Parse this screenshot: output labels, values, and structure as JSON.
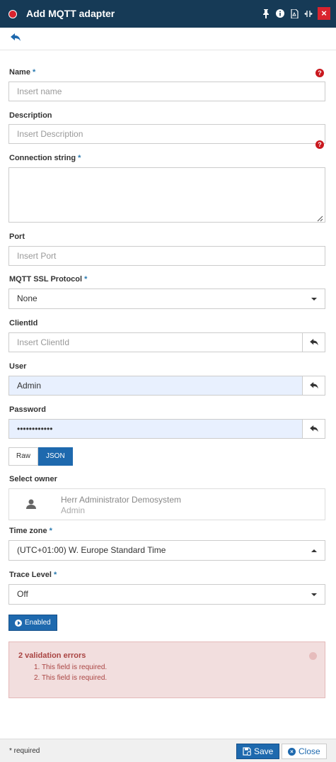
{
  "window": {
    "title": "Add MQTT adapter",
    "close_glyph": "×",
    "icons": [
      "pin-icon",
      "info-icon",
      "pdf-icon",
      "resize-icon"
    ]
  },
  "form": {
    "name": {
      "label": "Name",
      "required_mark": "*",
      "placeholder": "Insert name"
    },
    "description": {
      "label": "Description",
      "placeholder": "Insert Description"
    },
    "connection_string": {
      "label": "Connection string",
      "required_mark": "*"
    },
    "port": {
      "label": "Port",
      "placeholder": "Insert Port"
    },
    "ssl_protocol": {
      "label": "MQTT SSL Protocol",
      "required_mark": "*",
      "value": "None"
    },
    "client_id": {
      "label": "ClientId",
      "placeholder": "Insert ClientId"
    },
    "user": {
      "label": "User",
      "value": "Admin"
    },
    "password": {
      "label": "Password",
      "value": "••••••••••••"
    },
    "format_toggle": {
      "options": [
        "Raw",
        "JSON"
      ],
      "selected": "JSON"
    },
    "owner": {
      "label": "Select owner",
      "name": "Herr Administrator Demosystem",
      "sub": "Admin"
    },
    "time_zone": {
      "label": "Time zone",
      "required_mark": "*",
      "value": "(UTC+01:00) W. Europe Standard Time"
    },
    "trace_level": {
      "label": "Trace Level",
      "required_mark": "*",
      "value": "Off"
    },
    "enabled_label": "Enabled"
  },
  "alert": {
    "title": "2 validation errors",
    "items": [
      "1. This field is required.",
      "2. This field is required."
    ]
  },
  "footer": {
    "note": "* required",
    "save_label": "Save",
    "close_label": "Close"
  },
  "colors": {
    "header": "#163a56",
    "accent": "#1e69ae",
    "error": "#c9181e",
    "alert_bg": "#f2dede"
  }
}
